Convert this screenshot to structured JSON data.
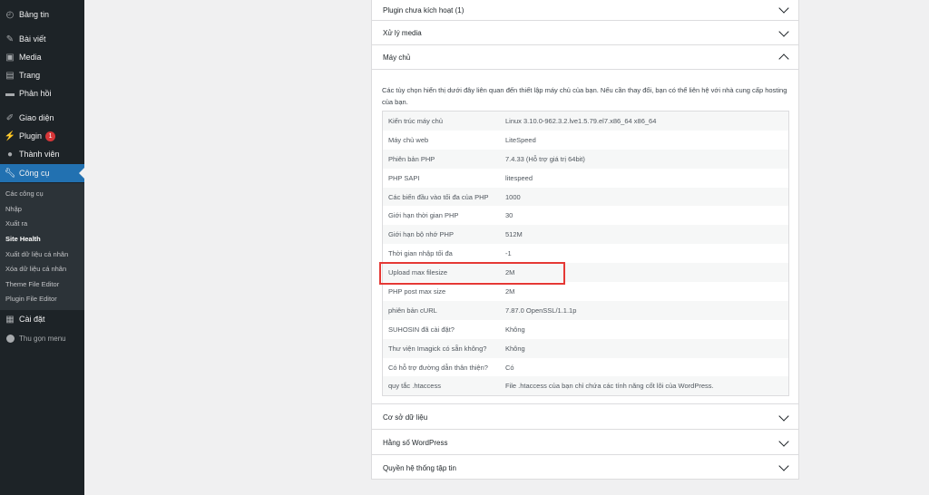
{
  "sidebar": {
    "items": [
      {
        "label": "Bảng tin",
        "icon": "dashboard-icon"
      },
      {
        "label": "Bài viết",
        "icon": "pin-icon"
      },
      {
        "label": "Media",
        "icon": "media-icon"
      },
      {
        "label": "Trang",
        "icon": "page-icon"
      },
      {
        "label": "Phản hồi",
        "icon": "comment-icon"
      },
      {
        "label": "Giao diện",
        "icon": "brush-icon"
      },
      {
        "label": "Plugin",
        "icon": "plugin-icon",
        "badge": "1"
      },
      {
        "label": "Thành viên",
        "icon": "user-icon"
      },
      {
        "label": "Công cụ",
        "icon": "wrench-icon"
      },
      {
        "label": "Cài đặt",
        "icon": "settings-icon"
      },
      {
        "label": "Thu gọn menu",
        "icon": "collapse-icon"
      }
    ],
    "submenu": [
      "Các công cụ",
      "Nhập",
      "Xuất ra",
      "Site Health",
      "Xuất dữ liệu cá nhân",
      "Xóa dữ liệu cá nhân",
      "Theme File Editor",
      "Plugin File Editor"
    ]
  },
  "panels": {
    "inactive_plugins": "Plugin chưa kích hoạt (1)",
    "media": "Xử lý media",
    "server": "Máy chủ",
    "database": "Cơ sở dữ liệu",
    "constants": "Hằng số WordPress",
    "filesystem": "Quyền hệ thống tập tin"
  },
  "server": {
    "description": "Các tùy chọn hiển thị dưới đây liên quan đến thiết lập máy chủ của bạn. Nếu cần thay đổi, bạn có thể liên hệ với nhà cung cấp hosting của bạn.",
    "rows": [
      {
        "key": "Kiến trúc máy chủ",
        "value": "Linux 3.10.0-962.3.2.lve1.5.79.el7.x86_64 x86_64"
      },
      {
        "key": "Máy chủ web",
        "value": "LiteSpeed"
      },
      {
        "key": "Phiên bản PHP",
        "value": "7.4.33 (Hỗ trợ giá trị 64bit)"
      },
      {
        "key": "PHP SAPI",
        "value": "litespeed"
      },
      {
        "key": "Các biến đầu vào tối đa của PHP",
        "value": "1000"
      },
      {
        "key": "Giới hạn thời gian PHP",
        "value": "30"
      },
      {
        "key": "Giới hạn bộ nhớ PHP",
        "value": "512M"
      },
      {
        "key": "Thời gian nhập tối đa",
        "value": "-1"
      },
      {
        "key": "Upload max filesize",
        "value": "2M"
      },
      {
        "key": "PHP post max size",
        "value": "2M"
      },
      {
        "key": "phiên bản cURL",
        "value": "7.87.0 OpenSSL/1.1.1p"
      },
      {
        "key": "SUHOSIN đã cài đặt?",
        "value": "Không"
      },
      {
        "key": "Thư viện Imagick có sẵn không?",
        "value": "Không"
      },
      {
        "key": "Có hỗ trợ đường dẫn thân thiện?",
        "value": "Có"
      },
      {
        "key": "quy tắc .htaccess",
        "value": "File .htaccess của bạn chỉ chứa các tính năng cốt lõi của WordPress."
      }
    ]
  },
  "colors": {
    "sidebar_bg": "#1d2327",
    "active_bg": "#2271b1",
    "highlight": "#e53935",
    "badge": "#d63638"
  }
}
